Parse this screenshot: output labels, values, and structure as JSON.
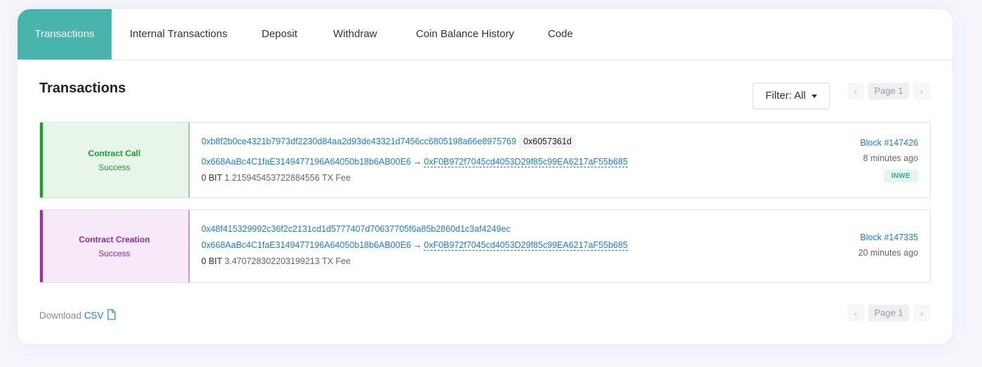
{
  "tabs": [
    {
      "label": "Transactions",
      "active": true
    },
    {
      "label": "Internal Transactions",
      "active": false
    },
    {
      "label": "Deposit",
      "active": false
    },
    {
      "label": "Withdraw",
      "active": false
    },
    {
      "label": "Coin Balance History",
      "active": false
    },
    {
      "label": "Code",
      "active": false
    }
  ],
  "section_title": "Transactions",
  "filter": {
    "label": "Filter: All"
  },
  "pager": {
    "prev": "‹",
    "page": "Page 1",
    "next": "›"
  },
  "transactions": [
    {
      "type": "Contract Call",
      "result": "Success",
      "hash": "0xb8f2b0ce4321b7973df2230d84aa2d93de43321d7456cc6805198a66e8975769",
      "method": "0x6057361d",
      "from": "0x668AaBc4C1faE3149477196A64050b18b6AB00E6",
      "arrow": "→",
      "to": "0xF0B972f7045cd4053D29f85c99EA6217aF55b685",
      "value": "0 BIT",
      "fee": "1.215945453722884556 TX Fee",
      "block": "Block #147426",
      "ago": "8 minutes ago",
      "tag": "INWE",
      "colors": {
        "bg": "#e8f6ea",
        "border": "#39b54a",
        "bar": "#16a52b",
        "text": "#169c2a"
      }
    },
    {
      "type": "Contract Creation",
      "result": "Success",
      "hash": "0x48f415329992c36f2c2131cd1d5777407d70637705f6a85b2860d1c3af4249ec",
      "from": "0x668AaBc4C1faE3149477196A64050b18b6AB00E6",
      "arrow": "→",
      "to": "0xF0B972f7045cd4053D29f85c99EA6217aF55b685",
      "value": "0 BIT",
      "fee": "3.470728302203199213 TX Fee",
      "block": "Block #147335",
      "ago": "20 minutes ago",
      "colors": {
        "bg": "#f7e9f7",
        "border": "#b04cc0",
        "bar": "#9b2eae",
        "text": "#8d2aa0"
      }
    }
  ],
  "download": {
    "prefix": "Download",
    "csv": "CSV"
  },
  "icons": {
    "file": "file-icon",
    "caret": "caret-down-icon",
    "prev": "chevron-left-icon",
    "next": "chevron-right-icon"
  },
  "colors": {
    "accent": "#49b4ab",
    "link": "#1a7ee0"
  }
}
